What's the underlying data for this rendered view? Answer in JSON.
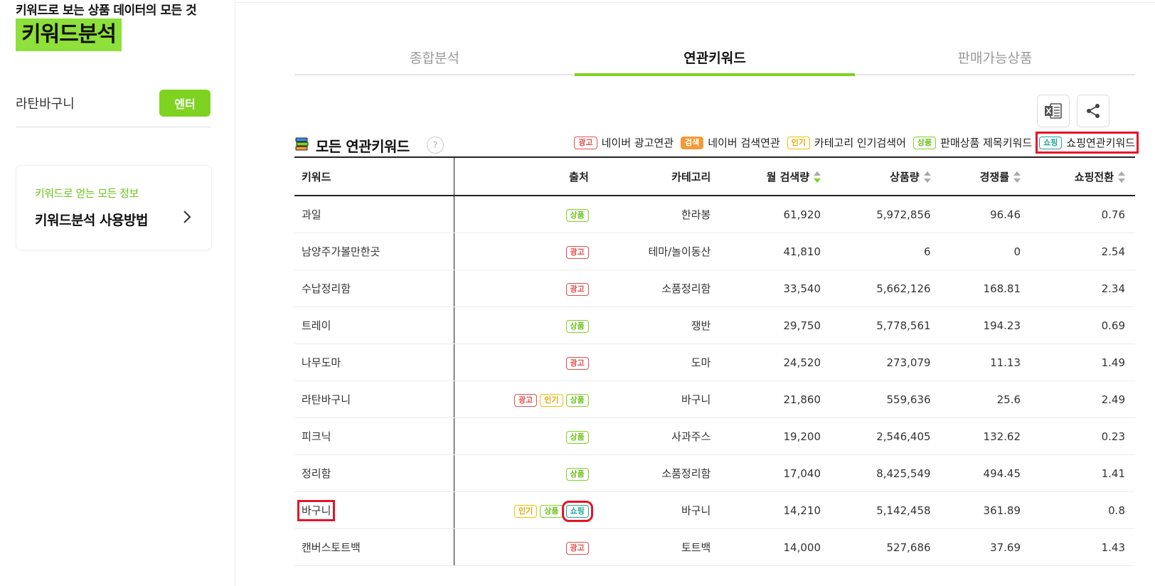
{
  "sidebar": {
    "tagline": "키워드로 보는 상품 데이터의 모든 것",
    "brand": "키워드분석",
    "search_value": "라탄바구니",
    "enter_label": "엔터",
    "guide_sub": "키워드로 얻는 모든 정보",
    "guide_title": "키워드분석 사용방법"
  },
  "tabs": [
    "종합분석",
    "연관키워드",
    "판매가능상품"
  ],
  "active_tab": 1,
  "section": {
    "title": "모든 연관키워드",
    "help": "?",
    "legend": [
      {
        "badge": "광고",
        "label": "네이버 광고연관"
      },
      {
        "badge": "검색",
        "label": "네이버 검색연관"
      },
      {
        "badge": "인기",
        "label": "카테고리 인기검색어"
      },
      {
        "badge": "상품",
        "label": "판매상품 제목키워드"
      },
      {
        "badge": "쇼핑",
        "label": "쇼핑연관키워드"
      }
    ]
  },
  "table": {
    "headers": [
      "키워드",
      "출처",
      "카테고리",
      "월 검색량",
      "상품량",
      "경쟁률",
      "쇼핑전환"
    ],
    "rows": [
      {
        "keyword": "과일",
        "sources": [
          "상품"
        ],
        "category": "한라봉",
        "search": "61,920",
        "products": "5,972,856",
        "competition": "96.46",
        "conversion": "0.76"
      },
      {
        "keyword": "남양주가볼만한곳",
        "sources": [
          "광고"
        ],
        "category": "테마/놀이동산",
        "search": "41,810",
        "products": "6",
        "competition": "0",
        "conversion": "2.54"
      },
      {
        "keyword": "수납정리함",
        "sources": [
          "광고"
        ],
        "category": "소품정리함",
        "search": "33,540",
        "products": "5,662,126",
        "competition": "168.81",
        "conversion": "2.34"
      },
      {
        "keyword": "트레이",
        "sources": [
          "상품"
        ],
        "category": "쟁반",
        "search": "29,750",
        "products": "5,778,561",
        "competition": "194.23",
        "conversion": "0.69"
      },
      {
        "keyword": "나무도마",
        "sources": [
          "광고"
        ],
        "category": "도마",
        "search": "24,520",
        "products": "273,079",
        "competition": "11.13",
        "conversion": "1.49"
      },
      {
        "keyword": "라탄바구니",
        "sources": [
          "광고",
          "인기",
          "상품"
        ],
        "category": "바구니",
        "search": "21,860",
        "products": "559,636",
        "competition": "25.6",
        "conversion": "2.49"
      },
      {
        "keyword": "피크닉",
        "sources": [
          "상품"
        ],
        "category": "사과주스",
        "search": "19,200",
        "products": "2,546,405",
        "competition": "132.62",
        "conversion": "0.23"
      },
      {
        "keyword": "정리함",
        "sources": [
          "상품"
        ],
        "category": "소품정리함",
        "search": "17,040",
        "products": "8,425,549",
        "competition": "494.45",
        "conversion": "1.41"
      },
      {
        "keyword": "바구니",
        "sources": [
          "인기",
          "상품",
          "쇼핑"
        ],
        "category": "바구니",
        "search": "14,210",
        "products": "5,142,458",
        "competition": "361.89",
        "conversion": "0.8"
      },
      {
        "keyword": "캔버스토트백",
        "sources": [
          "광고"
        ],
        "category": "토트백",
        "search": "14,000",
        "products": "527,686",
        "competition": "37.69",
        "conversion": "1.43"
      }
    ]
  },
  "icons": {
    "excel": "excel-download-icon",
    "share": "share-icon",
    "title": "stacked-books-icon",
    "chevron": "chevron-right-icon"
  },
  "colors": {
    "accent": "#7ed321",
    "highlight": "#e5142a",
    "ad": "#e05050",
    "search": "#f29b38",
    "popular": "#f0c000",
    "shopping": "#1aa596"
  }
}
